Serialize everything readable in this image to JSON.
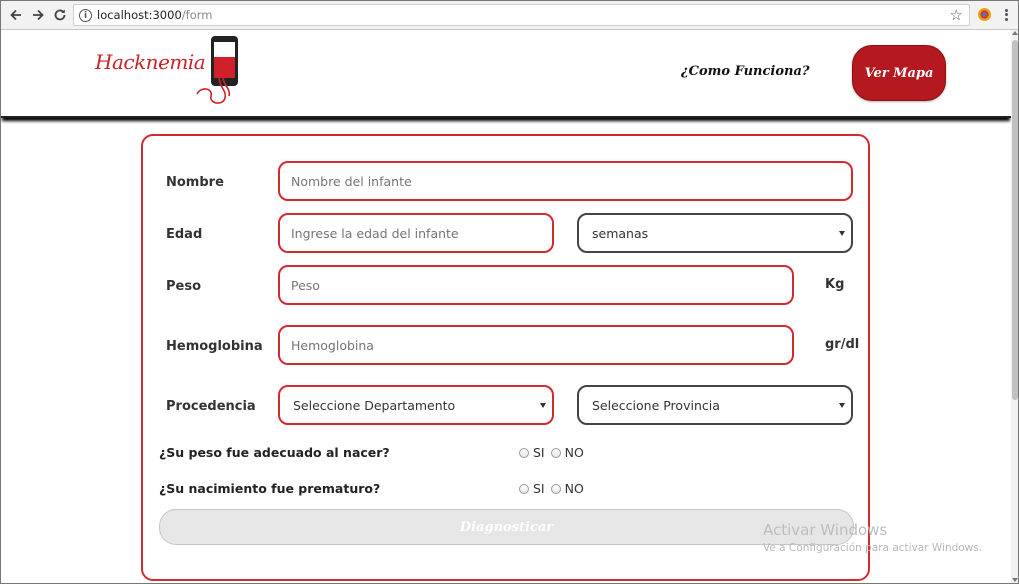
{
  "browser": {
    "url_host": "localhost:3000",
    "url_path": "/form"
  },
  "header": {
    "logo_text": "Hacknemia",
    "how_it_works_link": "¿Como Funciona?",
    "map_button": "Ver Mapa"
  },
  "form": {
    "nombre": {
      "label": "Nombre",
      "placeholder": "Nombre del infante"
    },
    "edad": {
      "label": "Edad",
      "placeholder": "Ingrese la edad del infante",
      "unit_selected": "semanas"
    },
    "peso": {
      "label": "Peso",
      "placeholder": "Peso",
      "unit": "Kg"
    },
    "hemoglobina": {
      "label": "Hemoglobina",
      "placeholder": "Hemoglobina",
      "unit": "gr/dl"
    },
    "procedencia": {
      "label": "Procedencia",
      "departamento": "Seleccione Departamento",
      "provincia": "Seleccione Provincia"
    },
    "q_peso": {
      "text": "¿Su peso fue adecuado al nacer?",
      "yes": "SI",
      "no": "NO"
    },
    "q_prematuro": {
      "text": "¿Su nacimiento fue prematuro?",
      "yes": "SI",
      "no": "NO"
    },
    "submit": "Diagnosticar"
  },
  "watermark": {
    "title": "Activar Windows",
    "subtitle": "Ve a Configuración para activar Windows."
  },
  "colors": {
    "accent": "#d32a30",
    "button": "#b3191f"
  }
}
